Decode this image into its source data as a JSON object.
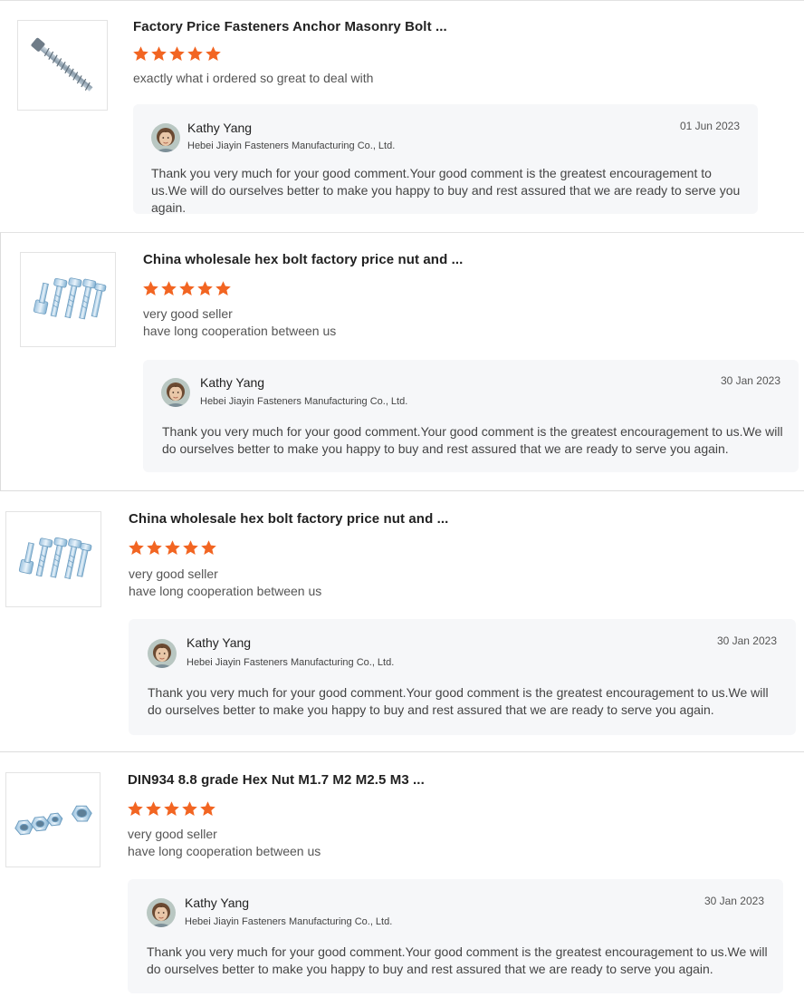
{
  "colors": {
    "star": "#f26522",
    "reply_bg": "#f6f7f9"
  },
  "reviews": [
    {
      "product_image": "anchor-bolt-image",
      "title": "Factory Price Fasteners Anchor Masonry Bolt ...",
      "rating": 5,
      "comment_lines": [
        "exactly what i ordered so great to deal with"
      ],
      "reply": {
        "name": "Kathy Yang",
        "company": "Hebei Jiayin Fasteners Manufacturing Co., Ltd.",
        "date": "01 Jun 2023",
        "text": "Thank you very much for your good comment.Your good comment is the greatest encouragement to us.We will do ourselves better to make you happy to buy and rest assured that we are ready to serve you again."
      }
    },
    {
      "product_image": "hex-bolts-image",
      "title": "China wholesale hex bolt factory price nut and ...",
      "rating": 5,
      "comment_lines": [
        "very good seller",
        "have long cooperation between us"
      ],
      "reply": {
        "name": "Kathy Yang",
        "company": "Hebei Jiayin Fasteners Manufacturing Co., Ltd.",
        "date": "30 Jan 2023",
        "text": "Thank you very much for your good comment.Your good comment is the greatest encouragement to us.We will do ourselves better to make you happy to buy and rest assured that we are ready to serve you again."
      }
    },
    {
      "product_image": "hex-bolts-image",
      "title": "China wholesale hex bolt factory price nut and ...",
      "rating": 5,
      "comment_lines": [
        "very good seller",
        "have long cooperation between us"
      ],
      "reply": {
        "name": "Kathy Yang",
        "company": "Hebei Jiayin Fasteners Manufacturing Co., Ltd.",
        "date": "30 Jan 2023",
        "text": "Thank you very much for your good comment.Your good comment is the greatest encouragement to us.We will do ourselves better to make you happy to buy and rest assured that we are ready to serve you again."
      }
    },
    {
      "product_image": "hex-nuts-image",
      "title": "DIN934 8.8 grade Hex Nut M1.7 M2 M2.5 M3 ...",
      "rating": 5,
      "comment_lines": [
        "very good seller",
        "have long cooperation between us"
      ],
      "reply": {
        "name": "Kathy Yang",
        "company": "Hebei Jiayin Fasteners Manufacturing Co., Ltd.",
        "date": "30 Jan 2023",
        "text": "Thank you very much for your good comment.Your good comment is the greatest encouragement to us.We will do ourselves better to make you happy to buy and rest assured that we are ready to serve you again."
      }
    }
  ]
}
